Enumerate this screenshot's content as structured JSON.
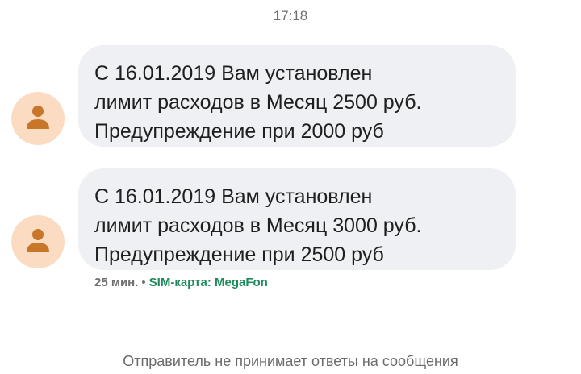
{
  "header": {
    "time": "17:18"
  },
  "messages": [
    {
      "text": "С 16.01.2019 Вам установлен\nлимит расходов в Месяц 2500 руб.\nПредупреждение при 2000 руб",
      "avatar_icon": "person-icon"
    },
    {
      "text": "С 16.01.2019 Вам установлен\nлимит расходов в Месяц 3000 руб.\nПредупреждение при 2500 руб",
      "avatar_icon": "person-icon"
    }
  ],
  "meta": {
    "age": "25 мин.",
    "separator": "•",
    "sim_label": "SIM-карта: MegaFon"
  },
  "footer": {
    "note": "Отправитель не принимает ответы на сообщения"
  },
  "colors": {
    "avatar_bg": "#fbdcc2",
    "avatar_fg": "#c8762a",
    "bubble_bg": "#eef0f3",
    "sim_accent": "#1f8a5b"
  }
}
